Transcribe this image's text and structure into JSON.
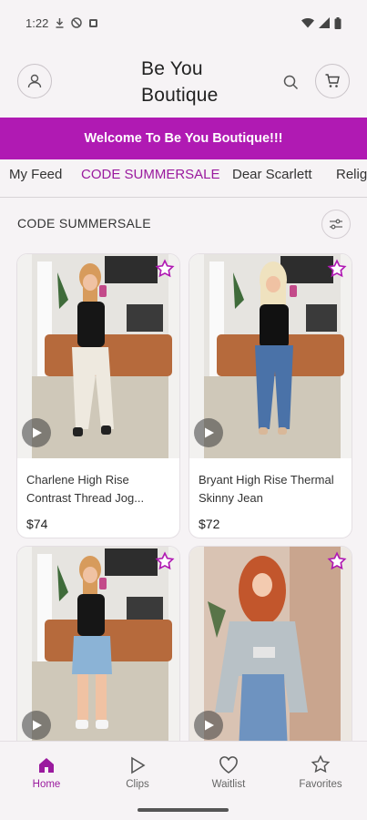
{
  "status": {
    "time": "1:22"
  },
  "header": {
    "title": "Be You Boutique"
  },
  "banner": {
    "text": "Welcome To Be You Boutique!!!",
    "color": "#b01ab3"
  },
  "tabs": [
    {
      "label": "My Feed",
      "active": false
    },
    {
      "label": "CODE SUMMERSALE",
      "active": true
    },
    {
      "label": "Dear Scarlett",
      "active": false
    },
    {
      "label": "Relig",
      "active": false
    }
  ],
  "section": {
    "title": "CODE SUMMERSALE"
  },
  "products": [
    {
      "name": "Charlene High Rise Contrast Thread Jog...",
      "price": "$74"
    },
    {
      "name": "Bryant High Rise Thermal Skinny Jean",
      "price": "$72"
    },
    {
      "name": "",
      "price": ""
    },
    {
      "name": "",
      "price": ""
    }
  ],
  "nav": [
    {
      "label": "Home",
      "icon": "home-icon",
      "active": true
    },
    {
      "label": "Clips",
      "icon": "play-icon",
      "active": false
    },
    {
      "label": "Waitlist",
      "icon": "heart-icon",
      "active": false
    },
    {
      "label": "Favorites",
      "icon": "star-icon",
      "active": false
    }
  ],
  "colors": {
    "accent": "#9a1a9e",
    "banner": "#b01ab3"
  }
}
